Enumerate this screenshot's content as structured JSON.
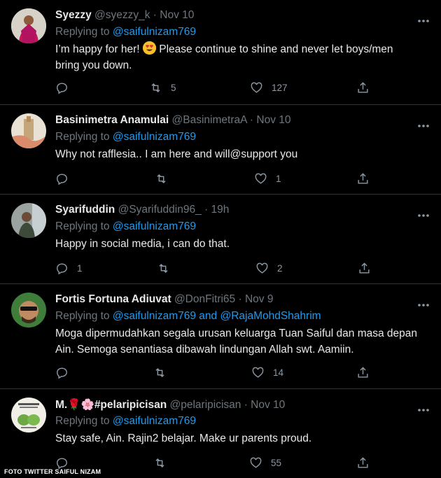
{
  "tweets": [
    {
      "name": "Syezzy",
      "meta": "@syezzy_k · Nov 10",
      "replying_prefix": "Replying to ",
      "replying_to": "@saifulnizam769",
      "text_before": "I’m happy for her! ",
      "emoji": "smiling-face-with-heart-eyes",
      "text_after": " Please continue to shine and never let boys/men bring you down.",
      "reply_count": "",
      "retweet_count": "5",
      "like_count": "127"
    },
    {
      "name": "Basinimetra Anamulai",
      "meta": "@BasinimetraA · Nov 10",
      "replying_prefix": "Replying to ",
      "replying_to": "@saifulnizam769",
      "text": "Why not rafflesia.. I am here and will@support you",
      "reply_count": "",
      "retweet_count": "",
      "like_count": "1"
    },
    {
      "name": "Syarifuddin",
      "meta": "@Syarifuddin96_ · 19h",
      "replying_prefix": "Replying to ",
      "replying_to": "@saifulnizam769",
      "text": "Happy in social media, i can do that.",
      "reply_count": "1",
      "retweet_count": "",
      "like_count": "2"
    },
    {
      "name": "Fortis Fortuna Adiuvat",
      "meta": "@DonFitri65 · Nov 9",
      "replying_prefix": "Replying to ",
      "replying_to": "@saifulnizam769 and @RajaMohdShahrim",
      "text": "Moga dipermudahkan segala urusan keluarga Tuan Saiful dan masa depan Ain. Semoga senantiasa dibawah lindungan Allah swt. Aamiin.",
      "reply_count": "",
      "retweet_count": "",
      "like_count": "14"
    },
    {
      "name": "M.🌹🌸#pelaripicisan",
      "meta": "@pelaripicisan · Nov 10",
      "replying_prefix": "Replying to ",
      "replying_to": "@saifulnizam769",
      "text": "Stay safe, Ain. Rajin2 belajar. Make ur parents proud.",
      "reply_count": "",
      "retweet_count": "",
      "like_count": "55"
    }
  ],
  "caption": "FOTO TWITTER SAIFUL NIZAM",
  "colors": {
    "background": "#000000",
    "link": "#1d9bf0",
    "muted": "#6e767d",
    "text": "#e7e9ea",
    "divider": "#2f3336"
  },
  "icons": [
    "reply-icon",
    "retweet-icon",
    "like-icon",
    "share-icon",
    "more-icon"
  ]
}
